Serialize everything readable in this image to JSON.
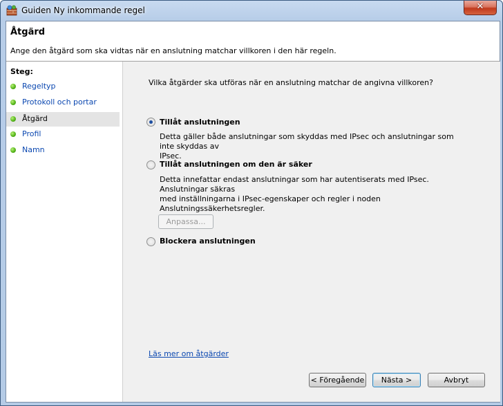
{
  "window": {
    "title": "Guiden Ny inkommande regel",
    "close_label": "✕"
  },
  "header": {
    "title": "Åtgärd",
    "subtitle": "Ange den åtgärd som ska vidtas när en anslutning matchar villkoren i den här regeln."
  },
  "sidebar": {
    "title": "Steg:",
    "items": [
      {
        "label": "Regeltyp"
      },
      {
        "label": "Protokoll och portar"
      },
      {
        "label": "Åtgärd",
        "active": true
      },
      {
        "label": "Profil"
      },
      {
        "label": "Namn"
      }
    ]
  },
  "main": {
    "question": "Vilka åtgärder ska utföras när en anslutning matchar de angivna villkoren?",
    "options": [
      {
        "label": "Tillåt anslutningen",
        "checked": true,
        "desc1": "Detta gäller både anslutningar som skyddas med IPsec och anslutningar som inte skyddas av",
        "desc2": "IPsec."
      },
      {
        "label": "Tillåt anslutningen om den är säker",
        "checked": false,
        "desc1": "Detta innefattar endast anslutningar som har autentiserats med IPsec. Anslutningar säkras",
        "desc2": "med inställningarna i IPsec-egenskaper och regler i noden Anslutningssäkerhetsregler."
      },
      {
        "label": "Blockera anslutningen",
        "checked": false
      }
    ],
    "customize_label": "Anpassa...",
    "learn_more": "Läs mer om åtgärder"
  },
  "buttons": {
    "back": "< Föregående",
    "next": "Nästa >",
    "cancel": "Avbryt"
  }
}
